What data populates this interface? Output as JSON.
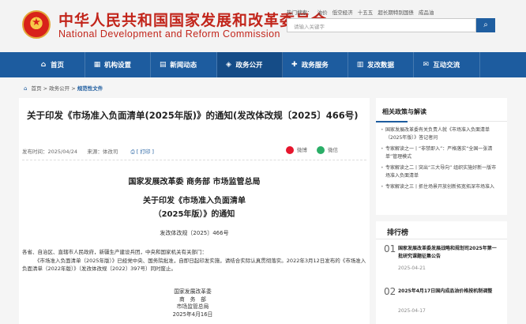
{
  "header": {
    "title_cn": "中华人民共和国国家发展和改革委员会",
    "title_en": "National Development and Reform Commission",
    "hot_words_label": "热门搜索：",
    "hot_words": [
      "油价",
      "低空经济",
      "十五五",
      "超长期特别国债",
      "成品油"
    ],
    "search_placeholder": "请输入关键字",
    "search_icon": "search-icon"
  },
  "nav": {
    "items": [
      {
        "label": "首页",
        "icon": "home-icon"
      },
      {
        "label": "机构设置",
        "icon": "building-icon"
      },
      {
        "label": "新闻动态",
        "icon": "news-icon"
      },
      {
        "label": "政务公开",
        "icon": "open-icon",
        "active": true
      },
      {
        "label": "政务服务",
        "icon": "service-icon"
      },
      {
        "label": "发改数据",
        "icon": "data-icon"
      },
      {
        "label": "互动交流",
        "icon": "chat-icon"
      }
    ],
    "active_color": "#154c87",
    "bar_color": "#1d5c9f"
  },
  "breadcrumb": {
    "home": "首页",
    "sep": " > ",
    "level1": "政务公开",
    "current": "规范性文件"
  },
  "article": {
    "title": "关于印发《市场准入负面清单(2025年版)》的通知(发改体改规〔2025〕466号)",
    "date": "发布时间：2025/04/24",
    "source": "来源：体改司",
    "print": "[ 打印 ]",
    "share_weibo": "微博",
    "share_wechat": "微信",
    "issuers": "国家发展改革委  商务部  市场监管总局",
    "doc_title_1": "关于印发《市场准入负面清单",
    "doc_title_2": "（2025年版）》的通知",
    "doc_number": "发改体改规〔2025〕466号",
    "addressees": "各省、自治区、直辖市人民政府，新疆生产建设兵团，中央和国家机关有关部门：",
    "body": "《市场准入负面清单（2025年版）》已经党中央、国务院批准，自即日起印发实施，请结合实际认真贯彻落实。2022年3月12日发布的《市场准入负面清单（2022年版）》（发改体改规〔2022〕397号）同时废止。",
    "sign": [
      "国家发展改革委",
      "商　务　部",
      "市场监管总局",
      "2025年4月16日"
    ]
  },
  "related": {
    "heading": "相关政策与解读",
    "items": [
      "国家发展改革委有关负责人就《市场准入负面清单（2025年版）》答记者问",
      "专家解读之一丨“非禁即入”：严格落实“全国一张清单”管理模式",
      "专家解读之二丨突出“三大导向” 组织实施好新一版市场准入负面清单",
      "专家解读之三丨抓住场景开放创新拓宽拓深市场准入"
    ]
  },
  "ranking": {
    "heading": "排行榜",
    "items": [
      {
        "num": "01",
        "title": "国家发展改革委发展战略和规划司2025年第一批研究课题征集公告",
        "date": "2025-04-21"
      },
      {
        "num": "02",
        "title": "2025年4月17日国内成品油价格按机制调整",
        "date": "2025-04-17"
      }
    ]
  }
}
